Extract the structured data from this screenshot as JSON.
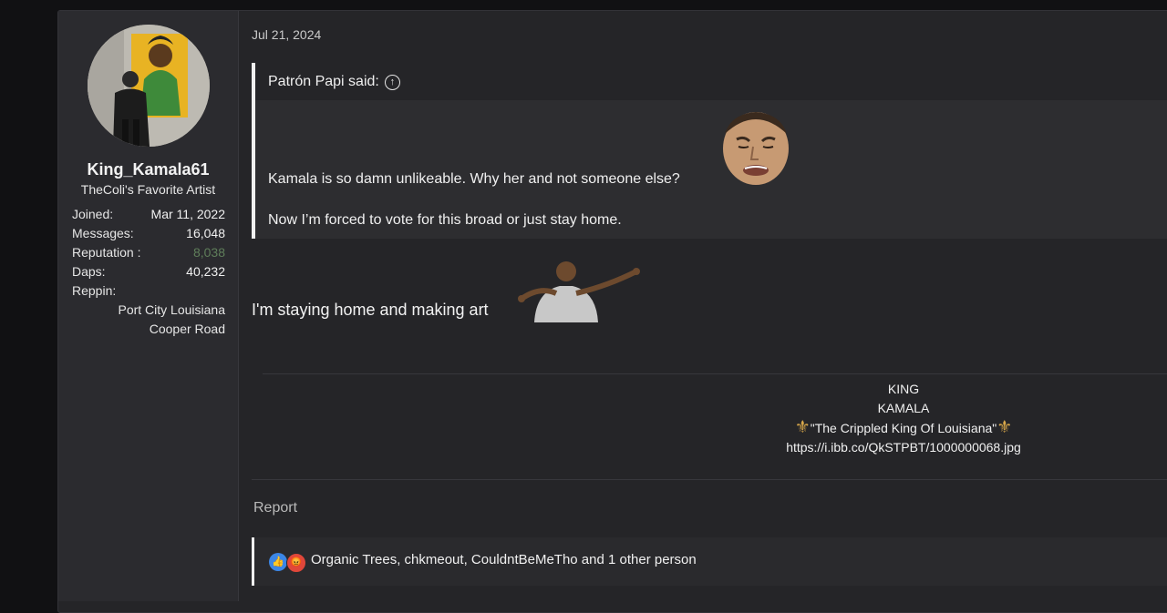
{
  "user": {
    "username": "King_Kamala61",
    "title": "TheColi's Favorite Artist",
    "stats": [
      {
        "label": "Joined:",
        "value": "Mar 11, 2022"
      },
      {
        "label": "Messages:",
        "value": "16,048"
      },
      {
        "label": "Reputation :",
        "value": "8,038"
      },
      {
        "label": "Daps:",
        "value": "40,232"
      }
    ],
    "reppin_label": "Reppin:",
    "reppin_lines": [
      "Port City Louisiana",
      "Cooper Road"
    ]
  },
  "post": {
    "date": "Jul 21, 2024",
    "quote": {
      "author": "Patrón Papi said:",
      "line1": "Kamala is so damn unlikeable. Why her and not someone else?",
      "line2": "Now I’m forced to vote for this broad or just stay home."
    },
    "body": "I'm staying home and making art",
    "signature": {
      "line1": "KING",
      "line2": "KAMALA",
      "line3": "\"The Crippled King Of Louisiana\"",
      "link": "https://i.ibb.co/QkSTPBT/1000000068.jpg"
    },
    "report_label": "Report",
    "reactions_text": "Organic Trees, chkmeout, CouldntBeMeTho and 1 other person"
  },
  "icons": {
    "quote_link": "arrow-up-circle-icon",
    "like": "thumbs-up-icon",
    "angry": "angry-face-icon",
    "signature": "fleur-de-lis-icon"
  },
  "colors": {
    "page_bg": "#111113",
    "post_bg": "#252528",
    "sidebar_bg": "#2b2b2f",
    "reputation": "#5f7e5a",
    "fleur": "#d9a84a",
    "like": "#3b86e6",
    "angry": "#e0473a"
  }
}
